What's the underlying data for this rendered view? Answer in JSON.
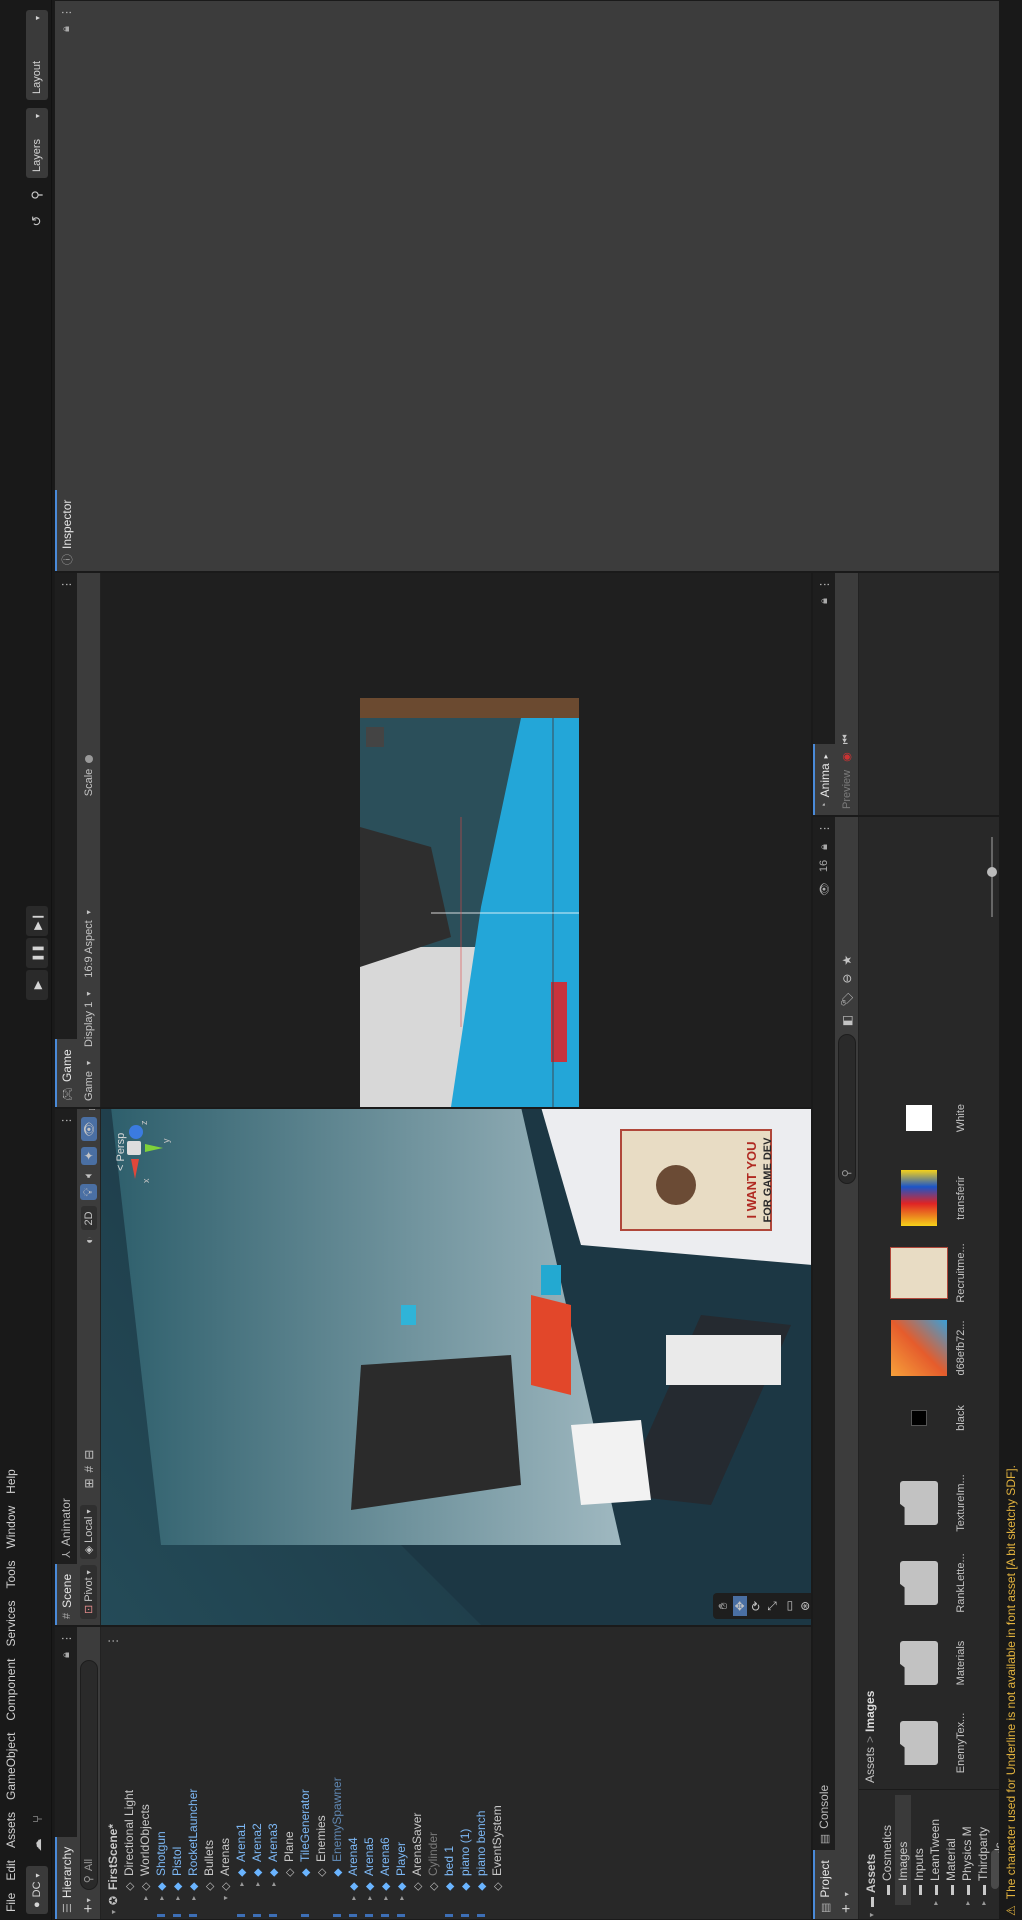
{
  "menu": [
    "File",
    "Edit",
    "Assets",
    "GameObject",
    "Component",
    "Services",
    "Tools",
    "Window",
    "Help"
  ],
  "toolbar": {
    "account": "DC",
    "layers_label": "Layers",
    "layout_label": "Layout"
  },
  "hierarchy": {
    "tab": "Hierarchy",
    "search_label": "All",
    "scene_name": "FirstScene*",
    "items": [
      {
        "label": "Directional Light",
        "indent": 1,
        "style": "gray",
        "arrow": ""
      },
      {
        "label": "WorldObjects",
        "indent": 1,
        "style": "gray",
        "arrow": "▸"
      },
      {
        "label": "Shotgun",
        "indent": 1,
        "style": "blue",
        "arrow": "▸"
      },
      {
        "label": "Pistol",
        "indent": 1,
        "style": "blue",
        "arrow": "▸"
      },
      {
        "label": "RocketLauncher",
        "indent": 1,
        "style": "blue",
        "arrow": "▸"
      },
      {
        "label": "Bullets",
        "indent": 1,
        "style": "gray",
        "arrow": ""
      },
      {
        "label": "Arenas",
        "indent": 1,
        "style": "gray",
        "arrow": "▾"
      },
      {
        "label": "Arena1",
        "indent": 2,
        "style": "blue",
        "arrow": "▸"
      },
      {
        "label": "Arena2",
        "indent": 2,
        "style": "blue",
        "arrow": "▸"
      },
      {
        "label": "Arena3",
        "indent": 2,
        "style": "blue",
        "arrow": "▸"
      },
      {
        "label": "Plane",
        "indent": 2,
        "style": "gray",
        "arrow": ""
      },
      {
        "label": "TileGenerator",
        "indent": 2,
        "style": "blue",
        "arrow": ""
      },
      {
        "label": "Enemies",
        "indent": 2,
        "style": "gray",
        "arrow": ""
      },
      {
        "label": "EnemySpawner",
        "indent": 2,
        "style": "dim",
        "arrow": ""
      },
      {
        "label": "Arena4",
        "indent": 1,
        "style": "blue",
        "arrow": "▸"
      },
      {
        "label": "Arena5",
        "indent": 1,
        "style": "blue",
        "arrow": "▸"
      },
      {
        "label": "Arena6",
        "indent": 1,
        "style": "blue",
        "arrow": "▸"
      },
      {
        "label": "Player",
        "indent": 1,
        "style": "blue",
        "arrow": "▸"
      },
      {
        "label": "ArenaSaver",
        "indent": 1,
        "style": "gray",
        "arrow": ""
      },
      {
        "label": "Cylinder",
        "indent": 1,
        "style": "dimgray",
        "arrow": ""
      },
      {
        "label": "bed 1",
        "indent": 1,
        "style": "blue",
        "arrow": ""
      },
      {
        "label": "piano (1)",
        "indent": 1,
        "style": "blue",
        "arrow": ""
      },
      {
        "label": "piano bench",
        "indent": 1,
        "style": "blue",
        "arrow": ""
      },
      {
        "label": "EventSystem",
        "indent": 1,
        "style": "gray",
        "arrow": ""
      }
    ]
  },
  "scene": {
    "tab_scene": "Scene",
    "tab_animator": "Animator",
    "pivot": "Pivot",
    "local": "Local",
    "mode_2d": "2D",
    "persp": "< Persp",
    "gizmo_x": "x",
    "gizmo_y": "y",
    "gizmo_z": "z",
    "poster_line1": "I WANT YOU",
    "poster_line2": "FOR GAME DEV"
  },
  "game": {
    "tab": "Game",
    "mode": "Game",
    "display": "Display 1",
    "aspect": "16:9 Aspect",
    "scale": "Scale"
  },
  "inspector": {
    "tab": "Inspector"
  },
  "project": {
    "tab_project": "Project",
    "tab_console": "Console",
    "root": "Assets",
    "breadcrumb_root": "Assets",
    "breadcrumb_sep": ">",
    "breadcrumb_current": "Images",
    "folders": [
      {
        "label": "Assets",
        "indent": 0,
        "arrow": "▾"
      },
      {
        "label": "Cosmetics",
        "indent": 1,
        "arrow": ""
      },
      {
        "label": "Images",
        "indent": 1,
        "arrow": ""
      },
      {
        "label": "Inputs",
        "indent": 1,
        "arrow": ""
      },
      {
        "label": "LeanTween",
        "indent": 1,
        "arrow": "▸"
      },
      {
        "label": "Material",
        "indent": 1,
        "arrow": ""
      },
      {
        "label": "Physics M",
        "indent": 1,
        "arrow": "▸"
      },
      {
        "label": "Thirdparty",
        "indent": 1,
        "arrow": "▸"
      },
      {
        "label": "Models",
        "indent": 1,
        "arrow": ""
      }
    ],
    "assets": [
      {
        "label": "EnemyTex...",
        "kind": "folder"
      },
      {
        "label": "Materials",
        "kind": "folder"
      },
      {
        "label": "RankLette...",
        "kind": "folder"
      },
      {
        "label": "TextureIm...",
        "kind": "folder"
      },
      {
        "label": "black",
        "kind": "black"
      },
      {
        "label": "d68efb72...",
        "kind": "room"
      },
      {
        "label": "Recruitme...",
        "kind": "poster"
      },
      {
        "label": "transferir",
        "kind": "colorful"
      },
      {
        "label": "White",
        "kind": "white"
      }
    ],
    "hidden_count": "16"
  },
  "animation": {
    "tab": "Anima",
    "preview": "Preview"
  },
  "status": {
    "warning": "The character used for Underline is not available in font asset [A bit sketchy SDF]."
  },
  "colors": {
    "accent": "#4a8ad8",
    "prefab_blue": "#7db8f5",
    "warning": "#e1b23e"
  }
}
